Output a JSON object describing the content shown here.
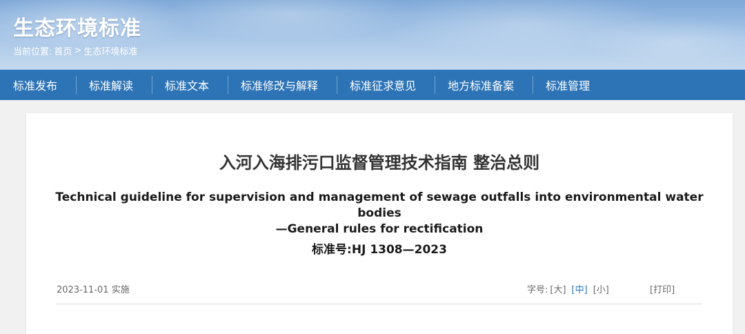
{
  "header": {
    "site_title": "生态环境标准",
    "breadcrumb": {
      "prefix": "当前位置:",
      "home": "首页",
      "separator": ">",
      "current": "生态环境标准"
    }
  },
  "nav": {
    "items": [
      {
        "label": "标准发布"
      },
      {
        "label": "标准解读"
      },
      {
        "label": "标准文本"
      },
      {
        "label": "标准修改与解释"
      },
      {
        "label": "标准征求意见"
      },
      {
        "label": "地方标准备案"
      },
      {
        "label": "标准管理"
      }
    ]
  },
  "document": {
    "title_cn": "入河入海排污口监督管理技术指南 整治总则",
    "title_en_line1": "Technical guideline for supervision and management of sewage outfalls into environmental water bodies",
    "title_en_line2": "—General rules for rectification",
    "standard_label": "标准号:",
    "standard_no": "HJ 1308—2023",
    "implement_date": "2023-11-01",
    "implement_suffix": "实施"
  },
  "font_size_tools": {
    "label": "字号:",
    "large": "[大]",
    "medium": "[中]",
    "small": "[小]",
    "print": "[打印]",
    "active": "medium"
  },
  "colors": {
    "nav_bg": "#2d74b7",
    "active_link": "#2d74b7",
    "page_bg": "#f1f1f1"
  }
}
